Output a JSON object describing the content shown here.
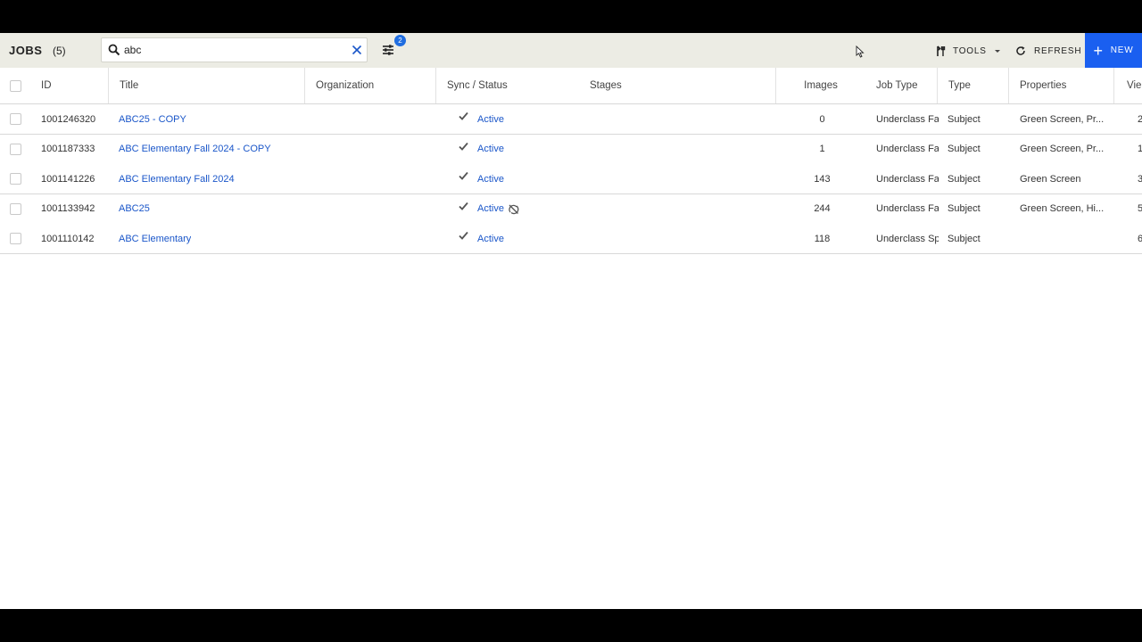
{
  "header": {
    "title": "JOBS",
    "count": "(5)",
    "filter_badge": "2",
    "tools_label": "TOOLS",
    "refresh_label": "REFRESH",
    "new_label": "NEW"
  },
  "search": {
    "value": "abc",
    "placeholder": ""
  },
  "columns": {
    "id": "ID",
    "title": "Title",
    "organization": "Organization",
    "sync_status": "Sync / Status",
    "stages": "Stages",
    "images": "Images",
    "job_type": "Job Type",
    "type": "Type",
    "properties": "Properties",
    "views": "Vie"
  },
  "rows": [
    {
      "id": "1001246320",
      "title": "ABC25 - COPY",
      "organization": "",
      "status": "Active",
      "stages": "",
      "images": "0",
      "job_type": "Underclass Fa",
      "type": "Subject",
      "properties": "Green Screen, Pr...",
      "views": "2"
    },
    {
      "id": "1001187333",
      "title": "ABC Elementary Fall 2024 - COPY",
      "organization": "",
      "status": "Active",
      "stages": "",
      "images": "1",
      "job_type": "Underclass Fa",
      "type": "Subject",
      "properties": "Green Screen, Pr...",
      "views": "1"
    },
    {
      "id": "1001141226",
      "title": "ABC Elementary Fall 2024",
      "organization": "",
      "status": "Active",
      "stages": "",
      "images": "143",
      "job_type": "Underclass Fa",
      "type": "Subject",
      "properties": "Green Screen",
      "views": "3"
    },
    {
      "id": "1001133942",
      "title": "ABC25",
      "organization": "",
      "status": "Active",
      "stages": "",
      "images": "244",
      "job_type": "Underclass Fa",
      "type": "Subject",
      "properties": "Green Screen, Hi...",
      "views": "5"
    },
    {
      "id": "1001110142",
      "title": "ABC Elementary",
      "organization": "",
      "status": "Active",
      "stages": "",
      "images": "118",
      "job_type": "Underclass Sp",
      "type": "Subject",
      "properties": "",
      "views": "6"
    }
  ],
  "colors": {
    "accent": "#1a5ff0",
    "link": "#1a56c9",
    "topbar": "#ecece4"
  },
  "icons": [
    "search-icon",
    "clear-icon",
    "filter-icon",
    "tools-icon",
    "refresh-icon",
    "plus-icon",
    "check-icon",
    "sync-off-icon"
  ]
}
